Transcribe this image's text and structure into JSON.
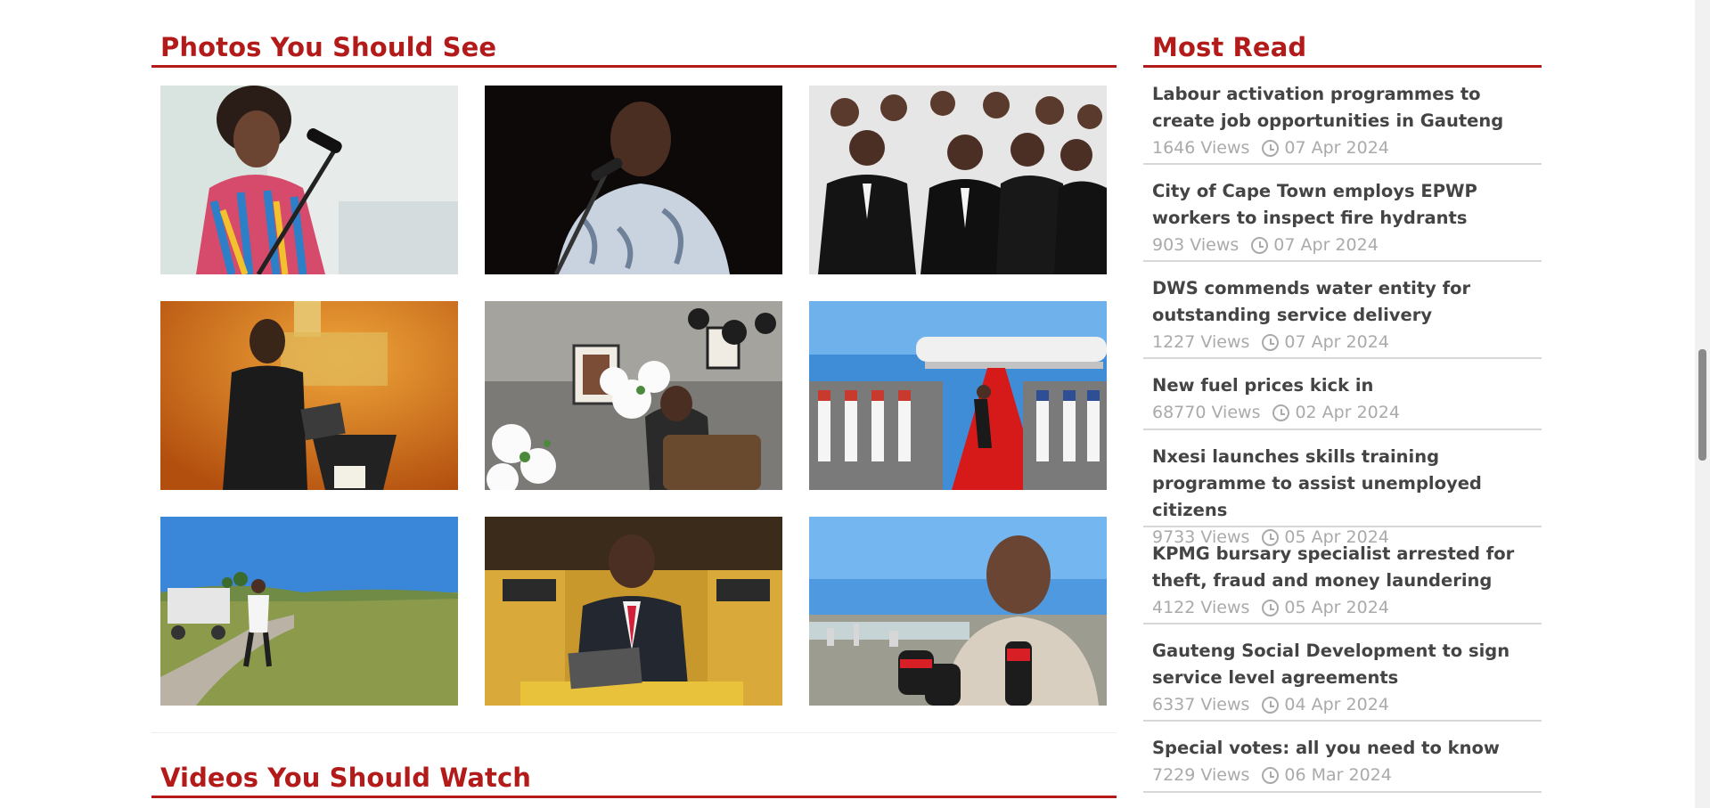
{
  "photos_section": {
    "title": "Photos You Should See",
    "photos": [
      {
        "name": "photo-woman-speaking-at-podium"
      },
      {
        "name": "photo-man-speaking-microphone"
      },
      {
        "name": "photo-dignitaries-in-black"
      },
      {
        "name": "photo-speaker-orange-backdrop"
      },
      {
        "name": "photo-signing-condolence-book"
      },
      {
        "name": "photo-red-carpet-guard-of-honour"
      },
      {
        "name": "photo-golf-course"
      },
      {
        "name": "photo-president-at-parliament-podium"
      },
      {
        "name": "photo-minister-press-interview"
      }
    ]
  },
  "videos_section": {
    "title": "Videos You Should Watch"
  },
  "most_read": {
    "title": "Most Read",
    "items": [
      {
        "title": "Labour activation programmes to create job opportunities in Gauteng",
        "views": "1646 Views",
        "date": "07 Apr 2024"
      },
      {
        "title": "City of Cape Town employs EPWP workers to inspect fire hydrants",
        "views": "903 Views",
        "date": "07 Apr 2024"
      },
      {
        "title": "DWS commends water entity for outstanding service delivery",
        "views": "1227 Views",
        "date": "07 Apr 2024"
      },
      {
        "title": "New fuel prices kick in",
        "views": "68770 Views",
        "date": "02 Apr 2024"
      },
      {
        "title": "Nxesi launches skills training programme to assist unemployed citizens",
        "views": "9733 Views",
        "date": "05 Apr 2024"
      },
      {
        "title": "KPMG bursary specialist arrested for theft, fraud and money laundering",
        "views": "4122 Views",
        "date": "05 Apr 2024"
      },
      {
        "title": "Gauteng Social Development to sign service level agreements",
        "views": "6337 Views",
        "date": "04 Apr 2024"
      },
      {
        "title": "Special votes: all you need to know",
        "views": "7229 Views",
        "date": "06 Mar 2024"
      }
    ]
  },
  "colors": {
    "accent": "#b31b1b",
    "meta_text": "#aaaaaa",
    "title_text": "#444444"
  },
  "icons": {
    "date": "clock-icon"
  }
}
